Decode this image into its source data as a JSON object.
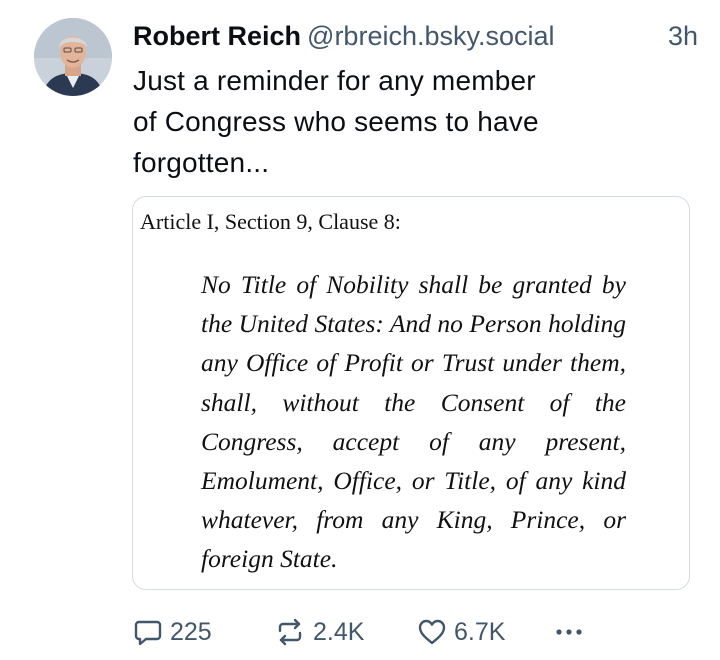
{
  "post": {
    "author": {
      "display_name": "Robert Reich",
      "handle": "@rbreich.bsky.social"
    },
    "timestamp": "3h",
    "text_lines": [
      "Just a reminder for any member",
      "of Congress who seems to have",
      "forgotten..."
    ],
    "embed": {
      "heading": "Article I, Section 9, Clause 8:",
      "quote": "No Title of Nobility shall be granted by the United States: And no Person holding any Office of Profit or Trust under them, shall, without the Consent of the Congress, accept of any present, Emolument, Office, or Title, of any kind whatever, from any King, Prince, or foreign State."
    },
    "actions": {
      "replies": "225",
      "reposts": "2.4K",
      "likes": "6.7K"
    }
  },
  "icons": {
    "reply": "speech-bubble-icon",
    "repost": "repost-arrows-icon",
    "like": "heart-icon",
    "more": "ellipsis-icon"
  },
  "colors": {
    "text_primary": "#0b0f14",
    "text_secondary": "#42576c",
    "card_border": "#d4dbe2"
  }
}
